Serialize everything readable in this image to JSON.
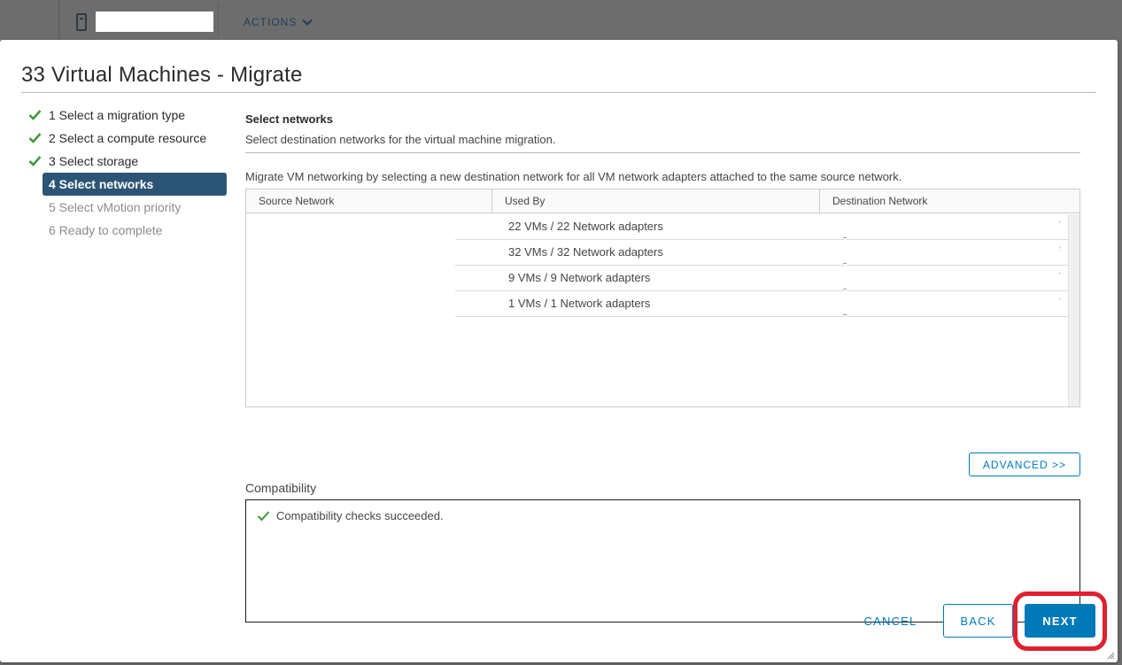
{
  "background": {
    "actions_label": "ACTIONS"
  },
  "dialog": {
    "title": "33 Virtual Machines - Migrate"
  },
  "steps": [
    {
      "label": "1 Select a migration type",
      "state": "done"
    },
    {
      "label": "2 Select a compute resource",
      "state": "done"
    },
    {
      "label": "3 Select storage",
      "state": "done"
    },
    {
      "label": "4 Select networks",
      "state": "active"
    },
    {
      "label": "5 Select vMotion priority",
      "state": "pending"
    },
    {
      "label": "6 Ready to complete",
      "state": "pending"
    }
  ],
  "page": {
    "title": "Select networks",
    "subtitle": "Select destination networks for the virtual machine migration.",
    "intro": "Migrate VM networking by selecting a new destination network for all VM network adapters attached to the same source network."
  },
  "grid": {
    "columns": [
      "Source Network",
      "Used By",
      "Destination Network"
    ],
    "rows": [
      {
        "source": "",
        "used_by": "22 VMs / 22 Network adapters",
        "destination": ""
      },
      {
        "source": "",
        "used_by": "32 VMs / 32 Network adapters",
        "destination": ""
      },
      {
        "source": "",
        "used_by": "9 VMs / 9 Network adapters",
        "destination": ""
      },
      {
        "source": "",
        "used_by": "1 VMs / 1 Network adapters",
        "destination": ""
      }
    ]
  },
  "advanced_label": "ADVANCED >>",
  "compatibility": {
    "label": "Compatibility",
    "message": "Compatibility checks succeeded."
  },
  "footer": {
    "cancel_label": "CANCEL",
    "back_label": "BACK",
    "next_label": "NEXT"
  },
  "colors": {
    "accent": "#0079b8",
    "active_step": "#2c5575",
    "success": "#3f9a3a",
    "highlight": "#e0202f"
  }
}
